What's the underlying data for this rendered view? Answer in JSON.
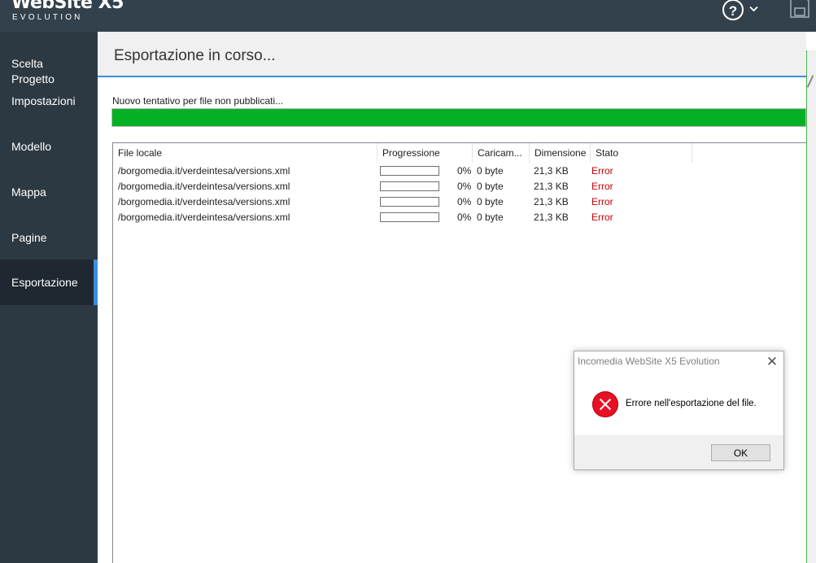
{
  "app": {
    "logo_line1": "WebSite X5",
    "logo_line2": "EVOLUTION",
    "help_symbol": "?",
    "help_chevron": "⌄",
    "accent": "#3a8ee0",
    "progress_color": "#06b025",
    "error_color": "#c50000"
  },
  "sidebar": {
    "items": [
      {
        "label": "Scelta\nProgetto",
        "active": false
      },
      {
        "label": "Impostazioni",
        "active": false
      },
      {
        "label": "Modello",
        "active": false
      },
      {
        "label": "Mappa",
        "active": false
      },
      {
        "label": "Pagine",
        "active": false
      },
      {
        "label": "Esportazione",
        "active": true
      }
    ]
  },
  "header": {
    "title": "Esportazione in corso..."
  },
  "status": {
    "text": "Nuovo tentativo per file non pubblicati...",
    "overall_progress": 1.0
  },
  "table": {
    "columns": [
      "File locale",
      "Progressione",
      "Caricam...",
      "Dimensione",
      "Stato"
    ],
    "rows": [
      {
        "file": "/borgomedia.it/verdeintesa/versions.xml",
        "progress": 0,
        "progress_text": "0%",
        "uploaded": "0 byte",
        "size": "21,3 KB",
        "status": "Error"
      },
      {
        "file": "/borgomedia.it/verdeintesa/versions.xml",
        "progress": 0,
        "progress_text": "0%",
        "uploaded": "0 byte",
        "size": "21,3 KB",
        "status": "Error"
      },
      {
        "file": "/borgomedia.it/verdeintesa/versions.xml",
        "progress": 0,
        "progress_text": "0%",
        "uploaded": "0 byte",
        "size": "21,3 KB",
        "status": "Error"
      },
      {
        "file": "/borgomedia.it/verdeintesa/versions.xml",
        "progress": 0,
        "progress_text": "0%",
        "uploaded": "0 byte",
        "size": "21,3 KB",
        "status": "Error"
      }
    ]
  },
  "dialog": {
    "title": "Incomedia WebSite X5 Evolution",
    "close_symbol": "✕",
    "message": "Errore nell'esportazione del file.",
    "ok_label": "OK",
    "icon": "error-icon"
  }
}
